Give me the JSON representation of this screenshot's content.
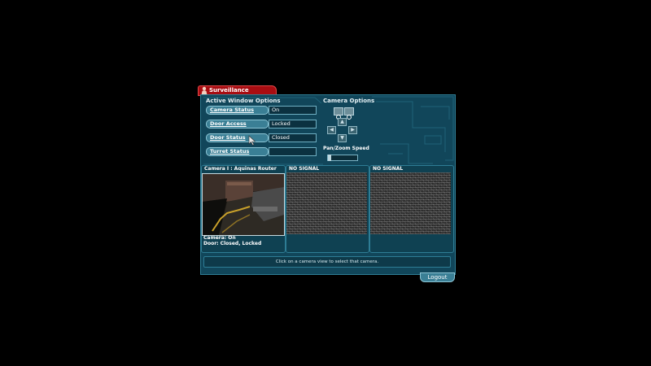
{
  "window": {
    "title": "Surveillance"
  },
  "active_window_options": {
    "header": "Active Window Options",
    "rows": [
      {
        "label": "Camera Status",
        "value": "On"
      },
      {
        "label": "Door Access",
        "value": "Locked"
      },
      {
        "label": "Door Status",
        "value": "Closed"
      },
      {
        "label": "Turret Status",
        "value": ""
      }
    ]
  },
  "camera_options": {
    "header": "Camera Options",
    "pan_zoom_label": "Pan/Zoom Speed"
  },
  "cameras": [
    {
      "title": "Camera I : Aquinas Router",
      "info_lines": [
        "Camera: On",
        "Door: Closed, Locked"
      ]
    },
    {
      "title": "NO SIGNAL"
    },
    {
      "title": "NO SIGNAL"
    }
  ],
  "status_text": "Click on a camera view to select that camera.",
  "logout_label": "Logout",
  "colors": {
    "panel": "#11465a",
    "title_tab": "#a80d12",
    "button": "#3a7f95"
  }
}
